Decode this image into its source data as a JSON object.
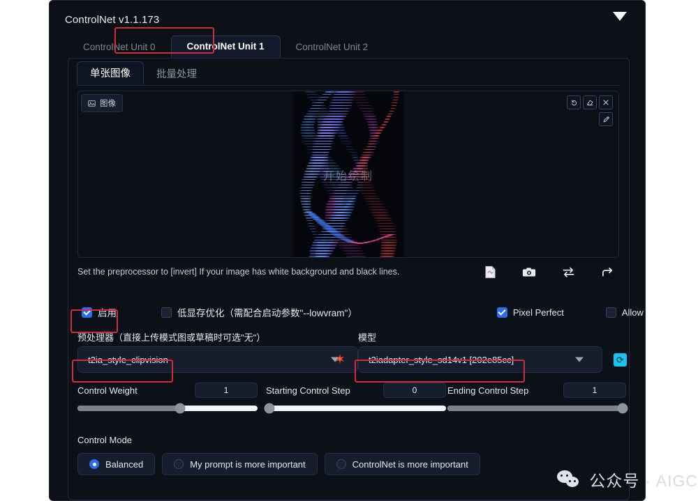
{
  "panel": {
    "title": "ControlNet v1.1.173",
    "collapse_icon": "chevron-down-icon"
  },
  "unit_tabs": [
    {
      "label": "ControlNet Unit 0",
      "active": false
    },
    {
      "label": "ControlNet Unit 1",
      "active": true
    },
    {
      "label": "ControlNet Unit 2",
      "active": false
    }
  ],
  "sub_tabs": [
    {
      "label": "单张图像",
      "active": true
    },
    {
      "label": "批量处理",
      "active": false
    }
  ],
  "dropzone": {
    "badge_label": "图像",
    "badge_icon": "image-icon",
    "tools": [
      {
        "name": "undo-icon",
        "glyph": "↺"
      },
      {
        "name": "eraser-icon",
        "glyph": "◢"
      },
      {
        "name": "close-icon",
        "glyph": "✕"
      },
      {
        "name": "pen-icon",
        "glyph": "✐"
      }
    ],
    "artwork_label": "开始绘制"
  },
  "hint": {
    "text": "Set the preprocessor to [invert] If your image has white background and black lines.",
    "icons": [
      {
        "name": "file-image-icon"
      },
      {
        "name": "camera-icon"
      },
      {
        "name": "swap-arrows-icon"
      },
      {
        "name": "send-arrow-icon"
      }
    ]
  },
  "checkboxes": [
    {
      "id": "enable",
      "label": "启用",
      "checked": true,
      "cn": true
    },
    {
      "id": "lowvram",
      "label": "低显存优化（需配合启动参数\"--lowvram\"）",
      "checked": false,
      "cn": true
    },
    {
      "id": "pixel",
      "label": "Pixel Perfect",
      "checked": true,
      "cn": false
    },
    {
      "id": "preview",
      "label": "Allow Preview",
      "checked": false,
      "cn": false
    }
  ],
  "preprocessor": {
    "label": "预处理器（直接上传模式图或草稿时可选\"无\"）",
    "value": "t2ia_style_clipvision",
    "caret_icon": "chevron-down-icon",
    "spark_icon": "spark-icon"
  },
  "model": {
    "label": "模型",
    "value": "t2iadapter_style_sd14v1 [202e85cc]",
    "caret_icon": "chevron-down-icon",
    "refresh_icon": "refresh-icon"
  },
  "sliders": [
    {
      "id": "weight",
      "label": "Control Weight",
      "value": "1",
      "percent": 57
    },
    {
      "id": "start",
      "label": "Starting Control Step",
      "value": "0",
      "percent": 2
    },
    {
      "id": "end",
      "label": "Ending Control Step",
      "value": "1",
      "percent": 98
    }
  ],
  "control_mode": {
    "label": "Control Mode",
    "options": [
      {
        "label": "Balanced",
        "selected": true
      },
      {
        "label": "My prompt is more important",
        "selected": false
      },
      {
        "label": "ControlNet is more important",
        "selected": false
      }
    ]
  },
  "watermark": {
    "text": "公众号 · AIGC",
    "logo_icon": "wechat-icon"
  },
  "colors": {
    "accent_blue": "#2c6bed",
    "highlight_red": "#cf2d3c",
    "panel_bg": "#0d1117",
    "refresh_cyan": "#17c6f0",
    "spark_orange": "#ff5a2b"
  }
}
